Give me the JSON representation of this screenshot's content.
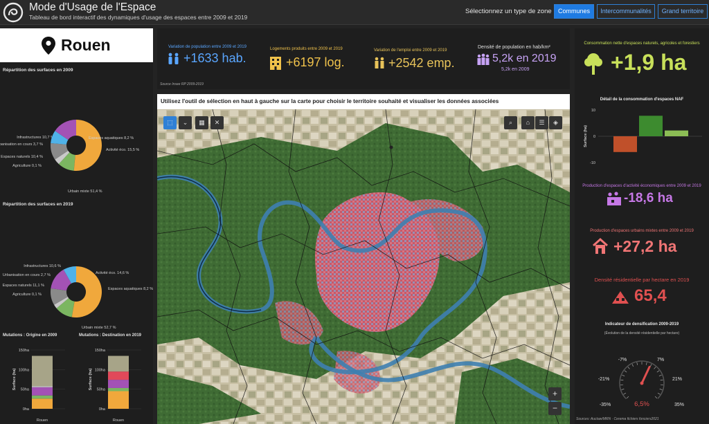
{
  "header": {
    "title": "Mode d'Usage de l'Espace",
    "subtitle": "Tableau de bord interactif des dynamiques d'usage des espaces entre 2009 et 2019",
    "zone_label": "Sélectionnez un type de zone",
    "zone_buttons": [
      "Communes",
      "Intercommunalités",
      "Grand territoire"
    ],
    "selected_zone": "Communes"
  },
  "city": {
    "name": "Rouen",
    "icon": "map-pin-icon"
  },
  "kpis": {
    "population": {
      "caption": "Variation de population entre 2009 et 2019",
      "value": "+1633 hab.",
      "icon": "people-icon",
      "color": "#5aa6ff"
    },
    "logements": {
      "caption": "Logements produits entre 2009 et 2019",
      "value": "+6197 log.",
      "icon": "building-icon",
      "color": "#f0c24b"
    },
    "emploi": {
      "caption": "Variation de l'emploi entre 2009 et 2019",
      "value": "+2542 emp.",
      "icon": "workers-icon",
      "color": "#e8c35a"
    },
    "densite": {
      "caption": "Densité de population en hab/km²",
      "value": "5,2k en 2019",
      "sub": "5,2k en 2009",
      "icon": "group-icon",
      "color": "#c7a3f5"
    },
    "source": "Source Insee RP 2009-2019"
  },
  "map": {
    "caption": "Utilisez l'outil de sélection en haut à gauche sur la carte pour choisir le territoire souhaité et visualiser les données associées",
    "tools_left": [
      "select-tool-icon",
      "chevron-down-icon",
      "box-select-icon",
      "close-icon"
    ],
    "tools_right": [
      "search-icon",
      "home-icon",
      "legend-icon",
      "layers-icon"
    ],
    "zoom_in": "+",
    "zoom_out": "−"
  },
  "chart_data": [
    {
      "type": "pie",
      "title": "Répartition des surfaces en 2009",
      "slices": [
        {
          "label": "Urbain mixte 51,4 %",
          "value": 51.4,
          "color": "#f0a83c"
        },
        {
          "label": "Agriculture 0,1 %",
          "value": 0.1,
          "color": "#f5d76e"
        },
        {
          "label": "Espaces naturels 10,4 %",
          "value": 10.4,
          "color": "#7bb661"
        },
        {
          "label": "Urbanisation en cours 3,7 %",
          "value": 3.7,
          "color": "#c9c9c9"
        },
        {
          "label": "Infrastructures 10,7 %",
          "value": 10.7,
          "color": "#8a8a8a"
        },
        {
          "label": "Espaces aquatiques 8,2 %",
          "value": 8.2,
          "color": "#4fb2e8"
        },
        {
          "label": "Activité éco. 15,5 %",
          "value": 15.5,
          "color": "#a352b5"
        }
      ]
    },
    {
      "type": "pie",
      "title": "Répartition des surfaces en 2019",
      "slices": [
        {
          "label": "Urbain mixte 52,7 %",
          "value": 52.7,
          "color": "#f0a83c"
        },
        {
          "label": "Agriculture 0,1 %",
          "value": 0.1,
          "color": "#f5d76e"
        },
        {
          "label": "Espaces naturels 11,1 %",
          "value": 11.1,
          "color": "#7bb661"
        },
        {
          "label": "Urbanisation en cours 2,7 %",
          "value": 2.7,
          "color": "#c9c9c9"
        },
        {
          "label": "Infrastructures 10,6 %",
          "value": 10.6,
          "color": "#8a8a8a"
        },
        {
          "label": "Activité éco. 14,6 %",
          "value": 14.6,
          "color": "#a352b5"
        },
        {
          "label": "Espaces aquatiques 8,2 %",
          "value": 8.2,
          "color": "#4fb2e8"
        }
      ]
    },
    {
      "type": "bar",
      "title": "Mutations : Origine en 2009",
      "ylabel": "Surface (ha)",
      "categories": [
        "Rouen"
      ],
      "ylim": [
        0,
        150
      ],
      "ticks": [
        "0ha",
        "50ha",
        "100ha",
        "150ha"
      ],
      "series": [
        {
          "values": [
            26
          ],
          "color": "#f0a83c"
        },
        {
          "values": [
            8
          ],
          "color": "#7bb661"
        },
        {
          "values": [
            21
          ],
          "color": "#a352b5"
        },
        {
          "values": [
            3
          ],
          "color": "#c9c9c9"
        },
        {
          "values": [
            77
          ],
          "color": "#a7a488"
        }
      ]
    },
    {
      "type": "bar",
      "title": "Mutations : Destination en 2019",
      "ylabel": "Surface (ha)",
      "categories": [
        "Rouen"
      ],
      "ylim": [
        0,
        150
      ],
      "ticks": [
        "0ha",
        "50ha",
        "100ha",
        "150ha"
      ],
      "series": [
        {
          "values": [
            45
          ],
          "color": "#f0a83c"
        },
        {
          "values": [
            8
          ],
          "color": "#7bb661"
        },
        {
          "values": [
            21
          ],
          "color": "#a352b5"
        },
        {
          "values": [
            21
          ],
          "color": "#e1495a"
        },
        {
          "values": [
            40
          ],
          "color": "#a7a488"
        }
      ]
    },
    {
      "type": "bar",
      "title": "Détail de la consommation d'espaces NAF",
      "ylabel": "Surface (ha)",
      "ylim": [
        -10,
        10
      ],
      "ticks": [
        "-10",
        "0",
        "10"
      ],
      "values": [
        -6.0,
        7.8,
        2.2
      ],
      "colors": [
        "#c0502a",
        "#3d8b2f",
        "#8cbd55"
      ]
    }
  ],
  "right": {
    "naf_caption": "Consommation nette d'espaces naturels, agricoles et forestiers",
    "naf_value": "+1,9 ha",
    "naf_icon": "tree-icon",
    "eco_caption": "Production d'espaces d'activité économiques entre 2009 et 2019",
    "eco_value": "-18,6 ha",
    "eco_icon": "factory-icon",
    "urb_caption": "Production d'espaces urbains mixtes entre 2009 et 2019",
    "urb_value": "+27,2 ha",
    "urb_icon": "house-icon",
    "dens_caption": "Densité résidentielle par hectare en 2019",
    "dens_value": "65,4",
    "dens_icon": "houses-icon",
    "gauge_title": "Indicateur de densification 2009-2019",
    "gauge_subtitle": "(Évolution de la densité résidentielle par hectare)",
    "gauge_value": 6.5,
    "gauge_value_label": "6,5%",
    "gauge_ticks": [
      "-35%",
      "-21%",
      "-7%",
      "7%",
      "21%",
      "35%"
    ],
    "sources": "Sources: Auctaw/MRN · Cerema fichiers fonciers2021"
  }
}
